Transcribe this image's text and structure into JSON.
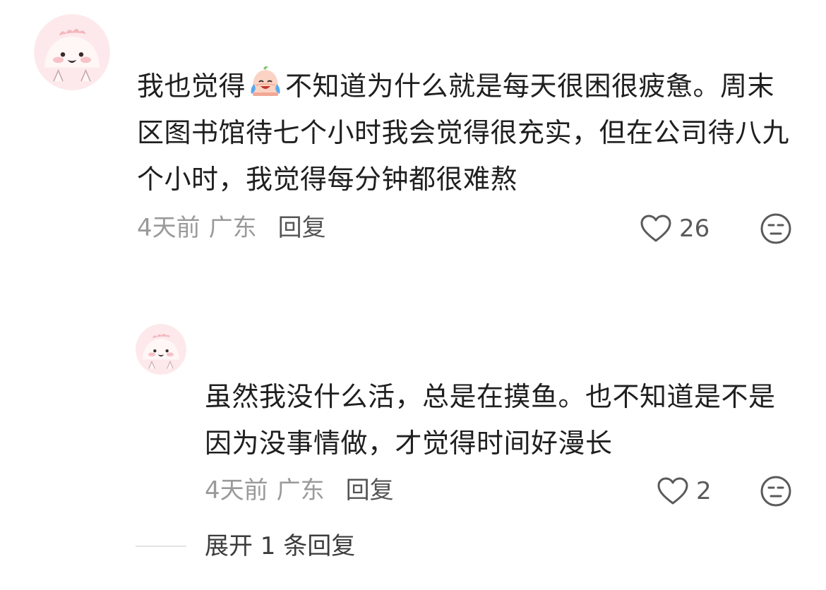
{
  "comment": {
    "text_before_emoji": "我也觉得",
    "emoji": "crying-laughing-sticker",
    "text_after_emoji": "不知道为什么就是每天很困很疲惫。周末区图书馆待七个小时我会觉得很充实，但在公司待八九个小时，我觉得每分钟都很难熬",
    "time": "4天前",
    "location": "广东",
    "reply_label": "回复",
    "likes": "26",
    "avatar": "pink-dinosaur-avatar"
  },
  "reply": {
    "text": "虽然我没什么活，总是在摸鱼。也不知道是不是因为没事情做，才觉得时间好漫长",
    "time": "4天前",
    "location": "广东",
    "reply_label": "回复",
    "likes": "2",
    "avatar": "pink-dinosaur-avatar"
  },
  "expand": {
    "label": "展开 1 条回复"
  },
  "colors": {
    "text": "#1f1f1f",
    "meta": "#9a9a9a",
    "avatar_bg": "#fbe6e8",
    "icon": "#5a5a5a"
  }
}
